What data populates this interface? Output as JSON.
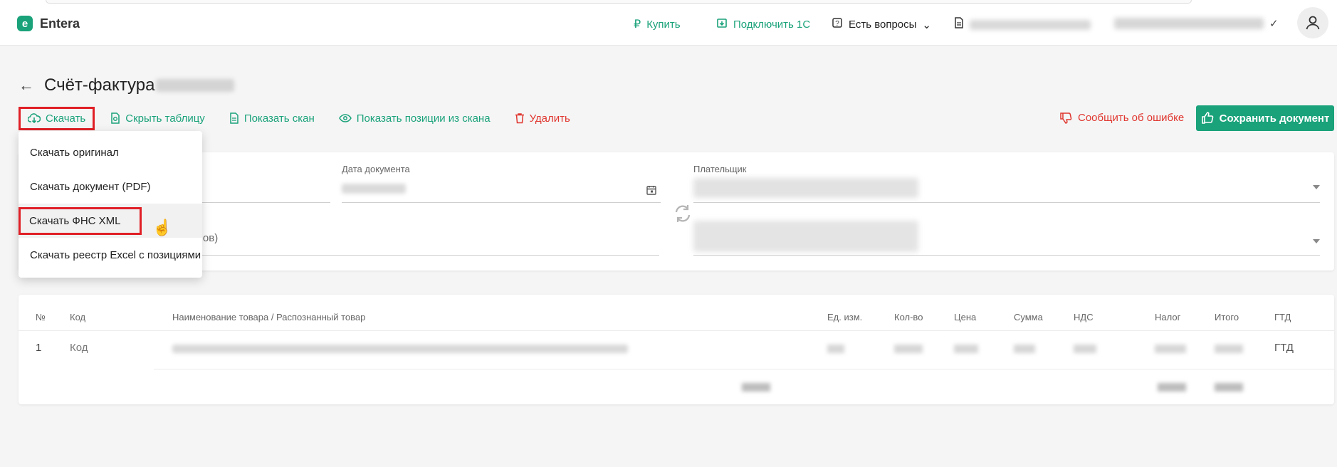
{
  "header": {
    "brand": "Entera",
    "buy": "Купить",
    "connect_1c": "Подключить 1С",
    "questions": "Есть вопросы",
    "doc_info": "",
    "company": ""
  },
  "page": {
    "title": "Счёт-фактура",
    "title_number": "",
    "toolbar": {
      "download": "Скачать",
      "hide_table": "Скрыть таблицу",
      "show_scan": "Показать скан",
      "show_positions": "Показать позиции из скана",
      "delete": "Удалить",
      "report_error": "Сообщить об ошибке",
      "save": "Сохранить документ"
    }
  },
  "download_menu": {
    "items": [
      "Скачать оригинал",
      "Скачать документ (PDF)",
      "Скачать ФНС XML",
      "Скачать реестр Excel с позициями"
    ]
  },
  "form": {
    "doc_date_label": "Дата документа",
    "doc_date_value": "",
    "payer_label": "Плательщик",
    "payer_value": "",
    "supplier_value": "",
    "partial_text": "лов)"
  },
  "table": {
    "headers": [
      "№",
      "Код",
      "Наименование товара / Распознанный товар",
      "Ед. изм.",
      "Кол-во",
      "Цена",
      "Сумма",
      "НДС",
      "Налог",
      "Итого",
      "ГТД"
    ],
    "rows": [
      {
        "num": "1",
        "code": "Код",
        "gtd": "ГТД"
      }
    ]
  },
  "colors": {
    "accent": "#1aa27a",
    "danger": "#e0362f",
    "highlight": "#e01f26"
  }
}
